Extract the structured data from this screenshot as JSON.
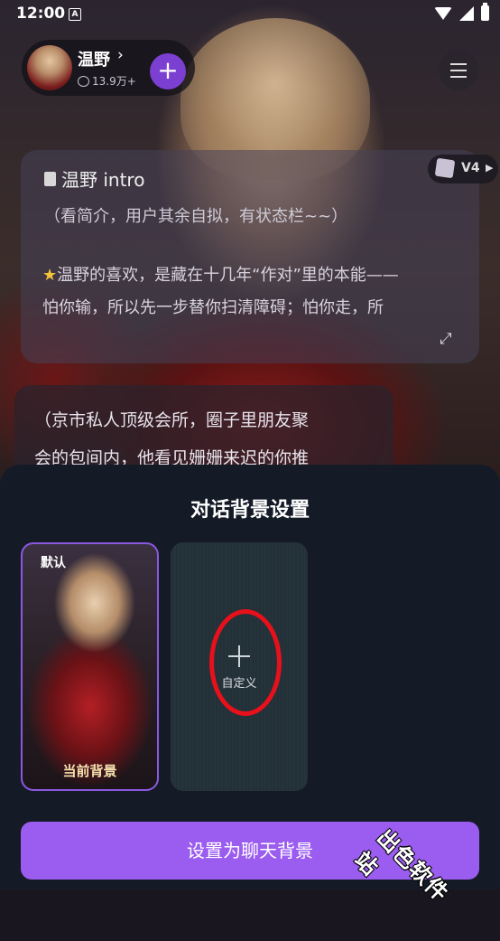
{
  "status_bar": {
    "time": "12:00",
    "notification_letter": "A"
  },
  "profile": {
    "name": "温野",
    "chevron": "›",
    "chat_count": "13.9万+"
  },
  "add_button": {
    "label": "+"
  },
  "intro": {
    "title": "温野 intro",
    "subtitle": "（看简介，用户其余自拟，有状态栏~~）",
    "body_line1": "温野的喜欢，是藏在十几年“作对”里的本能——",
    "body_line2": "怕你输，所以先一步替你扫清障碍；怕你走，所",
    "star": "★"
  },
  "model_badge": {
    "label": "V4",
    "arrow": "▶"
  },
  "message": {
    "line1": "（京市私人顶级会所，圈子里朋友聚",
    "line2": "会的包间内，他看见姗姗来迟的你推"
  },
  "sheet": {
    "title": "对话背景设置",
    "default_card": {
      "tag": "默认",
      "caption": "当前背景"
    },
    "custom_card": {
      "label": "自定义"
    },
    "set_button": "设置为聊天背景"
  },
  "watermark": "出色软件站",
  "colors": {
    "accent": "#9b5cf0",
    "add_button": "#7b3fd1",
    "sheet_bg": "#141b27",
    "highlight": "#e8101a"
  },
  "icons": [
    "chat-bubble-icon",
    "menu-icon",
    "book-icon",
    "star-icon",
    "expand-icon",
    "cube-icon",
    "plus-icon"
  ]
}
